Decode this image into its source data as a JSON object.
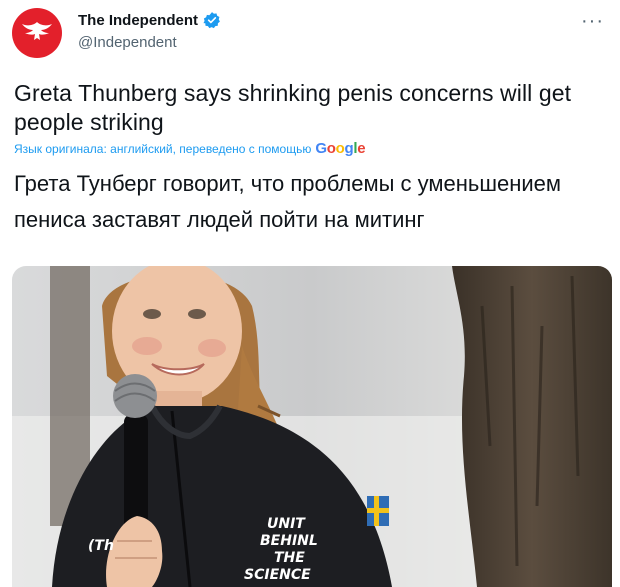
{
  "account": {
    "name": "The Independent",
    "handle": "@Independent",
    "avatar_icon": "eagle-icon",
    "verified_icon": "verified-badge-icon",
    "brand_color": "#e3202b"
  },
  "menu": {
    "more_label": "···"
  },
  "tweet": {
    "text": "Greta Thunberg says shrinking penis concerns will get people striking",
    "translation_note": "Язык оригинала: английский, переведено с помощью",
    "translation_provider": "Google",
    "translation": "Грета Тунберг говорит, что проблемы с уменьшением пениса заставят людей пойти на митинг"
  },
  "media": {
    "jacket_text": [
      "UNIT",
      "BEHINL",
      "THE",
      "SCIENCE"
    ],
    "sleeve_text": "(Th"
  }
}
